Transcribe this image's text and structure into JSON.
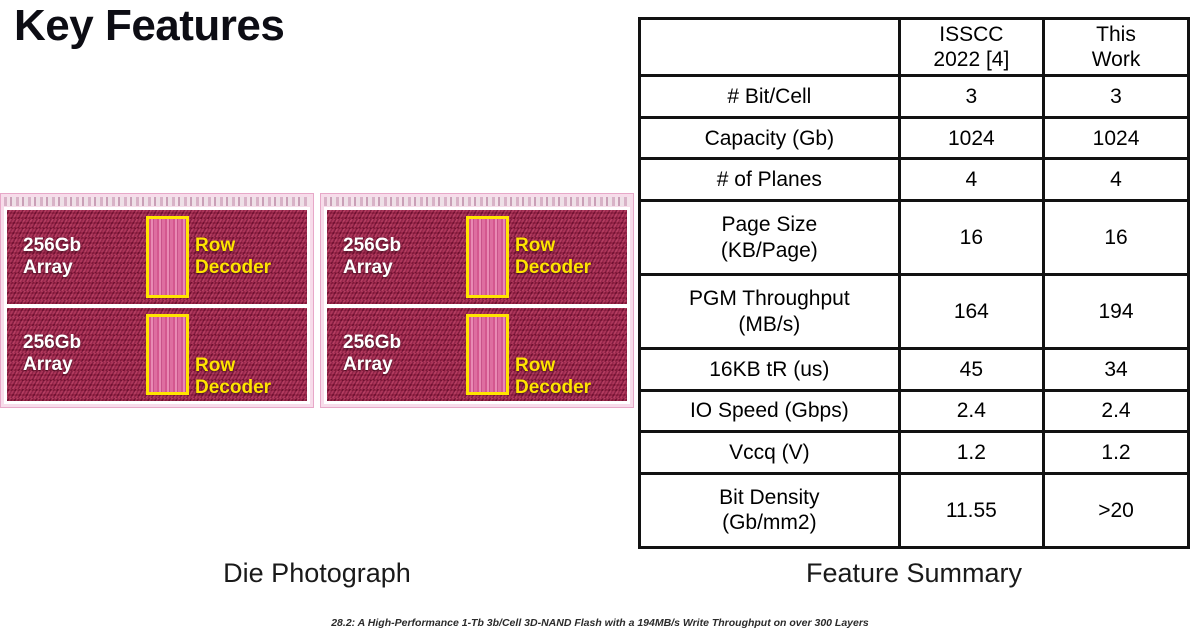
{
  "slide": {
    "title": "Key Features",
    "footer": "28.2: A High-Performance 1-Tb 3b/Cell 3D-NAND Flash with a 194MB/s Write Throughput on over 300 Layers"
  },
  "die_photo": {
    "caption": "Die Photograph",
    "array_label": "256Gb\nArray",
    "decoder_label": "Row\nDecoder",
    "colors": {
      "array_fill": "#9e2248",
      "decoder_outline": "#ffe400",
      "decoder_fill": "#d4578f",
      "frame": "#ffffff",
      "array_text": "#ffffff",
      "decoder_text": "#ffe400"
    },
    "quadrants": [
      {
        "array": "256Gb\nArray",
        "decoder": "Row\nDecoder"
      },
      {
        "array": "256Gb\nArray",
        "decoder": "Row\nDecoder"
      },
      {
        "array": "256Gb\nArray",
        "decoder": "Row\nDecoder"
      },
      {
        "array": "256Gb\nArray",
        "decoder": "Row\nDecoder"
      }
    ]
  },
  "feature_summary": {
    "caption": "Feature Summary",
    "columns": [
      "",
      "ISSCC\n2022 [4]",
      "This\nWork"
    ],
    "rows": [
      {
        "parameter": "# Bit/Cell",
        "isscc2022": "3",
        "this_work": "3"
      },
      {
        "parameter": "Capacity (Gb)",
        "isscc2022": "1024",
        "this_work": "1024"
      },
      {
        "parameter": "# of Planes",
        "isscc2022": "4",
        "this_work": "4"
      },
      {
        "parameter": "Page Size\n(KB/Page)",
        "isscc2022": "16",
        "this_work": "16"
      },
      {
        "parameter": "PGM Throughput\n(MB/s)",
        "isscc2022": "164",
        "this_work": "194"
      },
      {
        "parameter": "16KB tR (us)",
        "isscc2022": "45",
        "this_work": "34"
      },
      {
        "parameter": "IO Speed (Gbps)",
        "isscc2022": "2.4",
        "this_work": "2.4"
      },
      {
        "parameter": "Vccq (V)",
        "isscc2022": "1.2",
        "this_work": "1.2"
      },
      {
        "parameter": "Bit Density\n(Gb/mm2)",
        "isscc2022": "11.55",
        "this_work": ">20"
      }
    ]
  }
}
